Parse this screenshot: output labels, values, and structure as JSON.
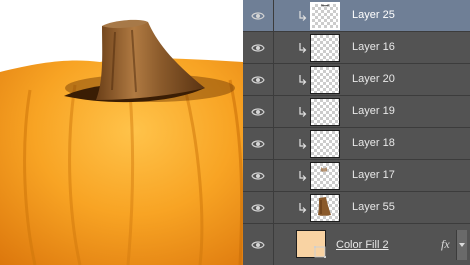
{
  "layers": [
    {
      "name": "Layer 25",
      "selected": true,
      "clipped": true,
      "thumb": "stem-top"
    },
    {
      "name": "Layer 16",
      "selected": false,
      "clipped": true,
      "thumb": "empty"
    },
    {
      "name": "Layer 20",
      "selected": false,
      "clipped": true,
      "thumb": "empty"
    },
    {
      "name": "Layer 19",
      "selected": false,
      "clipped": true,
      "thumb": "empty"
    },
    {
      "name": "Layer 18",
      "selected": false,
      "clipped": true,
      "thumb": "empty"
    },
    {
      "name": "Layer 17",
      "selected": false,
      "clipped": true,
      "thumb": "stem-dot"
    },
    {
      "name": "Layer 55",
      "selected": false,
      "clipped": true,
      "thumb": "stem"
    },
    {
      "name": "Color Fill 2",
      "selected": false,
      "clipped": false,
      "thumb": "fill",
      "fx": "fx"
    }
  ],
  "icons": {
    "visibility": "eye-icon",
    "clipping": "clipping-arrow-icon",
    "effects": "fx-icon",
    "scroll": "chevron-down-icon"
  },
  "colors": {
    "panel_bg": "#535353",
    "selected_row": "#6f7f96",
    "pumpkin": "#f39a1c",
    "stem": "#8a5a2b",
    "fill_swatch": "#f9d3a3"
  }
}
